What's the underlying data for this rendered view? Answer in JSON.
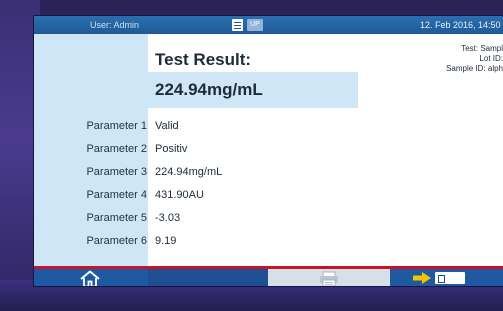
{
  "status": {
    "user": "User: Admin",
    "up_badge": "UP",
    "datetime": "12. Feb 2016, 14:50"
  },
  "result": {
    "title": "Test Result:",
    "value": "224.94mg/mL"
  },
  "test_info": {
    "test": "Test: Sampl",
    "lot": "Lot ID:",
    "sample": "Sample ID: alph"
  },
  "parameters": [
    {
      "label": "Parameter 1",
      "value": "Valid"
    },
    {
      "label": "Parameter 2",
      "value": "Positiv"
    },
    {
      "label": "Parameter 3",
      "value": "224.94mg/mL"
    },
    {
      "label": "Parameter 4",
      "value": "431.90AU"
    },
    {
      "label": "Parameter 5",
      "value": "-3.03"
    },
    {
      "label": "Parameter 6",
      "value": "9.19"
    }
  ],
  "nav": {
    "home_icon": "home-icon",
    "print_icon": "printer-icon",
    "next_icon": "arrow-right-icon",
    "exit_icon": "exit-icon"
  },
  "colors": {
    "statusbar": "#1f5a96",
    "panel": "#cfe6f6",
    "navbar": "#1d4f92",
    "accent_red": "#c4162b",
    "arrow": "#f2c500"
  }
}
